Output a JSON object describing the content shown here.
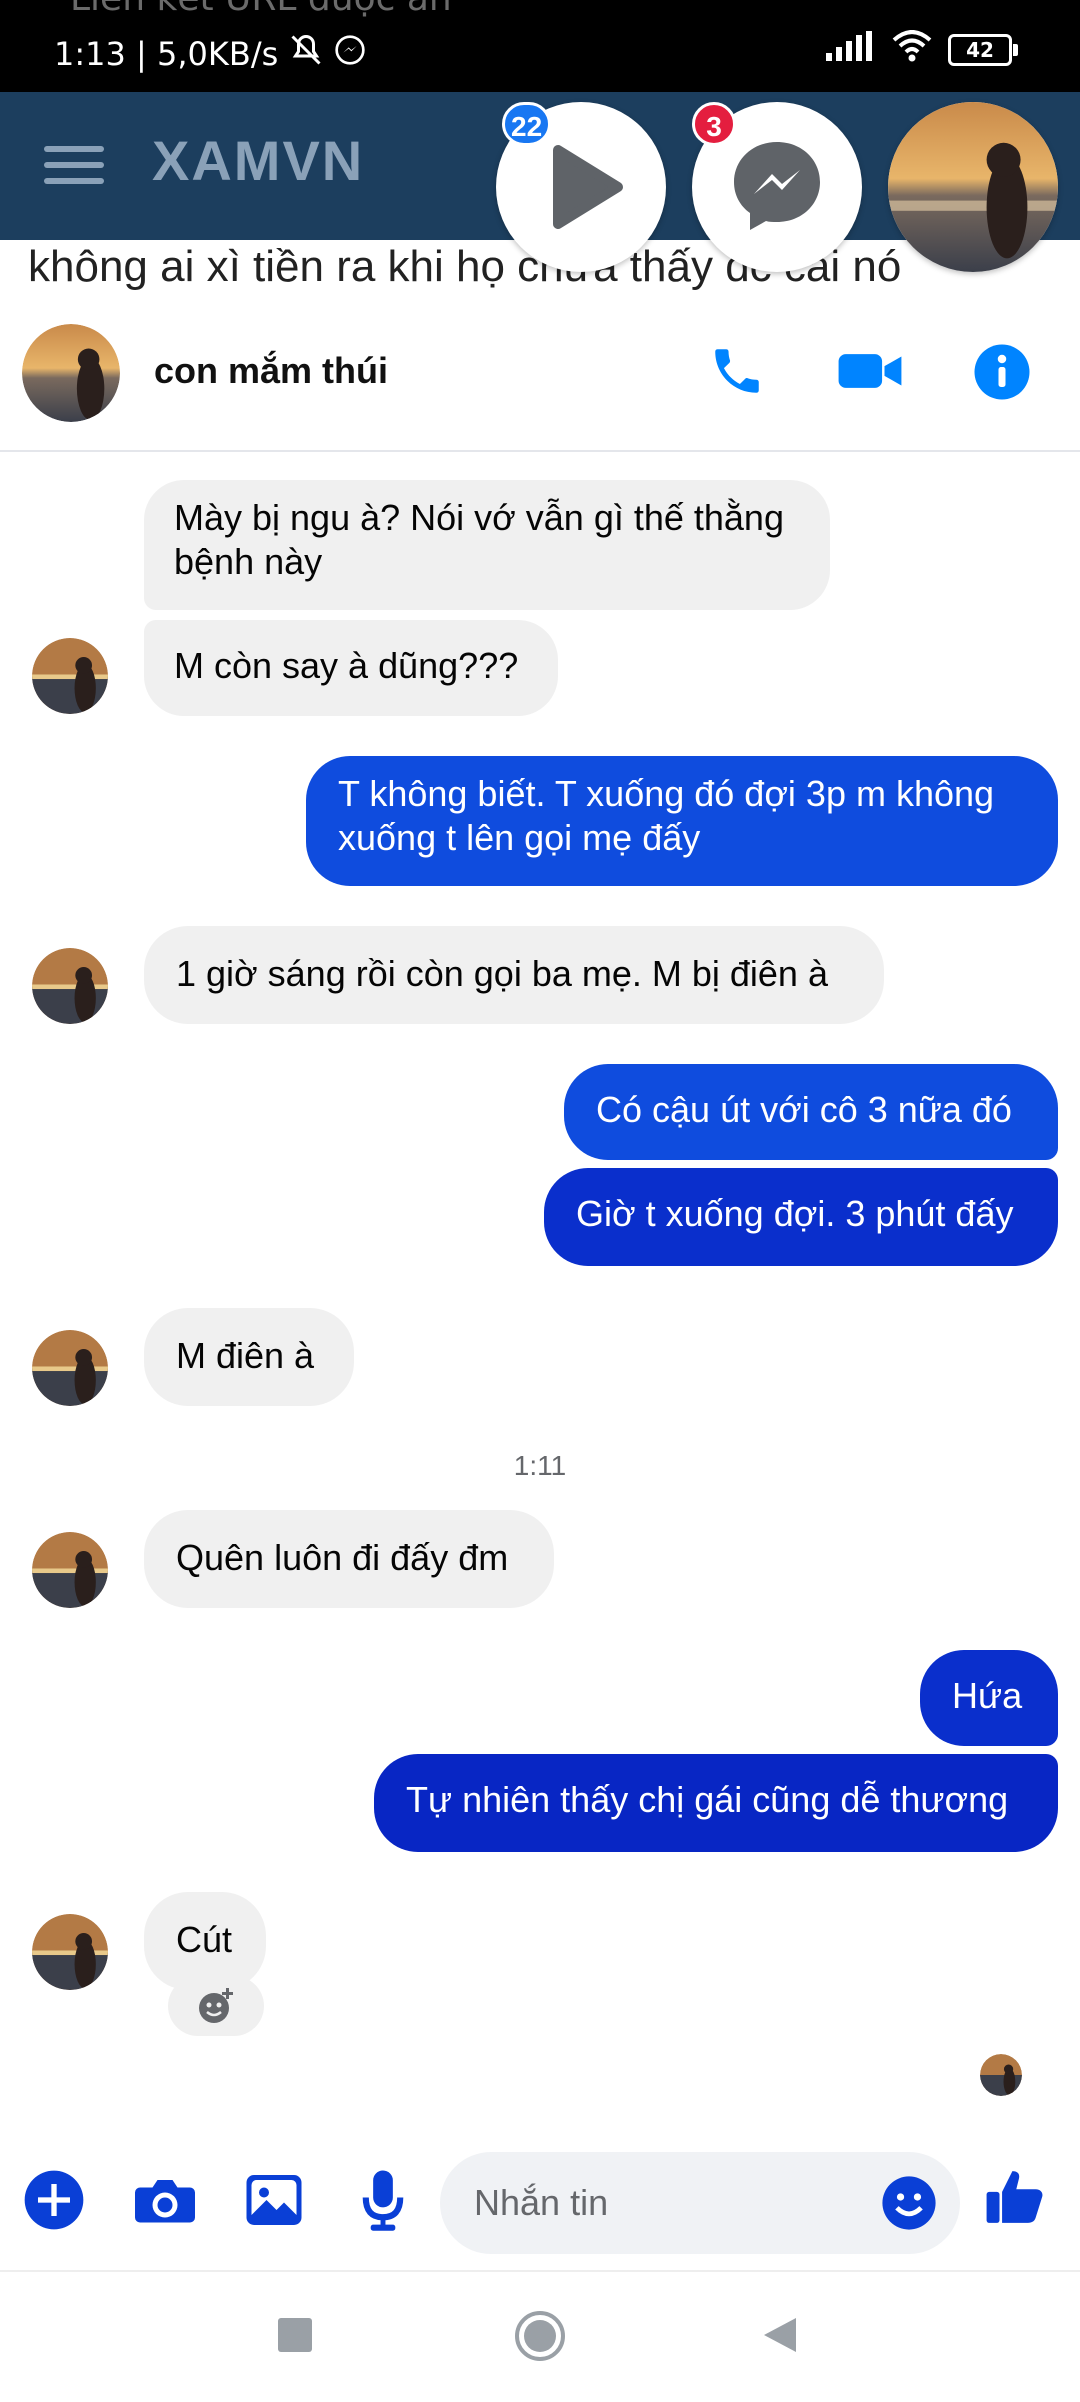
{
  "status_bar": {
    "notification_ghost": "Liên kết URL được ẩn",
    "time_speed": "1:13 | 5,0KB/s",
    "battery": "42"
  },
  "underlay": {
    "brand": "XAMVN",
    "text": "không ai xì tiền ra khi họ chưa thấy dc cái nó"
  },
  "chat_heads": [
    {
      "icon": "play-icon",
      "badge": "22",
      "badge_color": "#1877f2"
    },
    {
      "icon": "messenger-icon",
      "badge": "3",
      "badge_color": "#e41e3f"
    },
    {
      "icon": "contact-avatar"
    }
  ],
  "header": {
    "contact_name": "con mắm thúi",
    "call_icon": "phone-icon",
    "video_icon": "video-camera-icon",
    "info_icon": "info-icon"
  },
  "messages": [
    {
      "dir": "in",
      "text_lines": [
        "Mày bị ngu à? Nói vớ vẫn gì thế thằng",
        "bệnh này"
      ]
    },
    {
      "dir": "in",
      "text": "M còn say à dũng???"
    },
    {
      "dir": "out",
      "text_lines": [
        "T không biết. T xuống đó đợi 3p m không",
        "xuống t lên gọi mẹ đấy"
      ]
    },
    {
      "dir": "in",
      "text": "1 giờ sáng rồi còn gọi ba mẹ. M bị điên à"
    },
    {
      "dir": "out",
      "text": "Có cậu út với cô 3 nữa đó"
    },
    {
      "dir": "out",
      "text": "Giờ t xuống đợi. 3 phút đấy"
    },
    {
      "dir": "in",
      "text": "M điên à"
    },
    {
      "dir": "in",
      "text": "Quên luôn đi đấy đm"
    },
    {
      "dir": "out",
      "text": "Hứa"
    },
    {
      "dir": "out",
      "text": "Tự nhiên thấy chị gái cũng dễ thương"
    },
    {
      "dir": "in",
      "text": "Cút"
    }
  ],
  "timestamp": "1:11",
  "composer": {
    "placeholder": "Nhắn tin",
    "icons": [
      "plus-icon",
      "camera-icon",
      "image-icon",
      "microphone-icon",
      "emoji-icon",
      "like-icon"
    ]
  },
  "colors": {
    "accent": "#0084ff",
    "outgoing_bubble": "#0f4cde",
    "incoming_bubble": "#f0f0f0"
  }
}
